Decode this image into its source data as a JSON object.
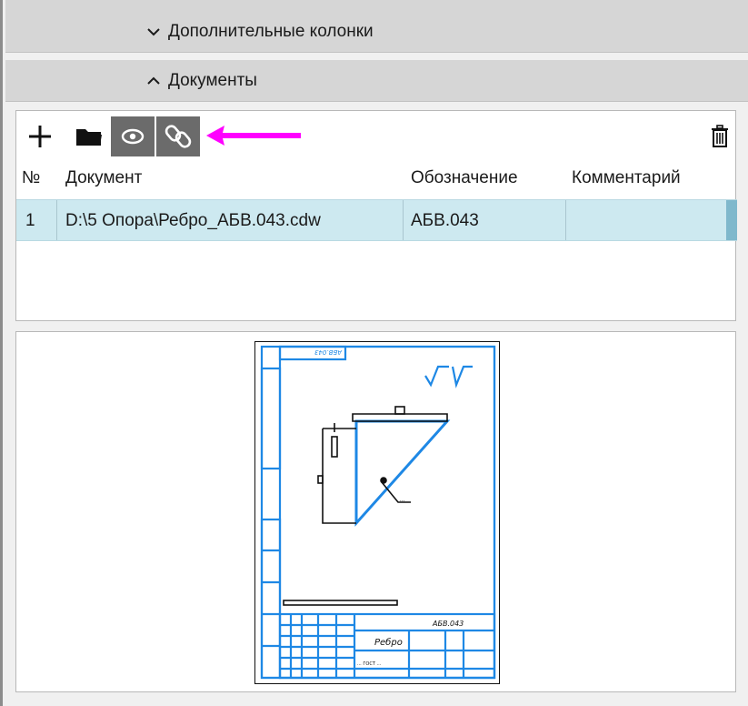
{
  "sections": {
    "extra_columns": {
      "label": "Дополнительные колонки",
      "state": "collapsed"
    },
    "documents": {
      "label": "Документы",
      "state": "expanded"
    }
  },
  "toolbar": {
    "add": {
      "icon": "plus-icon"
    },
    "open": {
      "icon": "folder-icon"
    },
    "view": {
      "icon": "eye-icon"
    },
    "link": {
      "icon": "link-icon"
    },
    "delete": {
      "icon": "trash-icon"
    }
  },
  "table": {
    "columns": [
      "№",
      "Документ",
      "Обозначение",
      "Комментарий"
    ],
    "rows": [
      {
        "num": "1",
        "document": "D:\\5 Опора\\Ребро_АБВ.043.cdw",
        "designation": "АБВ.043",
        "comment": ""
      }
    ]
  },
  "preview": {
    "drawing_code": "АБВ.043",
    "drawing_name": "Ребро",
    "inverted_stamp": "АБВ.043",
    "roughness": "√ (√)",
    "material": "... ГОСТ ...",
    "leader_note": "..."
  },
  "colors": {
    "drawing_blue": "#1e88e5",
    "arrow_magenta": "#ff00ff",
    "selected_row": "#cde9f0"
  }
}
